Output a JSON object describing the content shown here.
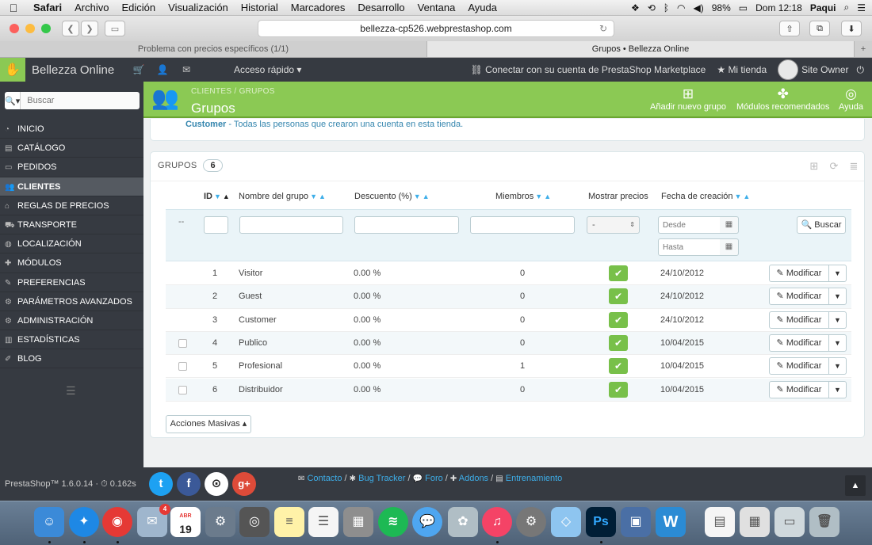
{
  "menubar": {
    "app": "Safari",
    "menus": [
      "Archivo",
      "Edición",
      "Visualización",
      "Historial",
      "Marcadores",
      "Desarrollo",
      "Ventana",
      "Ayuda"
    ],
    "battery": "98%",
    "clock": "Dom 12:18",
    "user": "Paqui"
  },
  "browser": {
    "url": "bellezza-cp526.webprestashop.com",
    "tabs": [
      {
        "title": "Problema con precios específicos (1/1)",
        "active": false
      },
      {
        "title": "Grupos • Bellezza Online",
        "active": true
      }
    ],
    "new_tab": "+"
  },
  "header": {
    "shop_name": "Bellezza Online",
    "quick_access": "Acceso rápido",
    "connect": "Conectar con su cuenta de PrestaShop Marketplace",
    "my_shop": "Mi tienda",
    "owner": "Site Owner"
  },
  "sidebar": {
    "search_placeholder": "Buscar",
    "items": [
      {
        "label": "INICIO",
        "icon": "dashboard-icon"
      },
      {
        "label": "CATÁLOGO",
        "icon": "book-icon"
      },
      {
        "label": "PEDIDOS",
        "icon": "credit-card-icon"
      },
      {
        "label": "CLIENTES",
        "icon": "users-icon",
        "active": true
      },
      {
        "label": "REGLAS DE PRECIOS",
        "icon": "tags-icon"
      },
      {
        "label": "TRANSPORTE",
        "icon": "truck-icon"
      },
      {
        "label": "LOCALIZACIÓN",
        "icon": "globe-icon"
      },
      {
        "label": "MÓDULOS",
        "icon": "puzzle-icon"
      },
      {
        "label": "PREFERENCIAS",
        "icon": "wrench-icon"
      },
      {
        "label": "PARÁMETROS AVANZADOS",
        "icon": "cogs-icon"
      },
      {
        "label": "ADMINISTRACIÓN",
        "icon": "cog-icon"
      },
      {
        "label": "ESTADÍSTICAS",
        "icon": "bar-chart-icon"
      },
      {
        "label": "BLOG",
        "icon": "edit-icon"
      }
    ]
  },
  "page": {
    "breadcrumb": [
      "CLIENTES",
      "GRUPOS"
    ],
    "title": "Grupos",
    "actions": {
      "add": "Añadir nuevo grupo",
      "modules": "Módulos recomendados",
      "help": "Ayuda"
    },
    "info_bold": "Customer",
    "info_text": " - Todas las personas que crearon una cuenta en esta tienda."
  },
  "groups": {
    "title": "GRUPOS",
    "count": "6",
    "columns": {
      "id": "ID",
      "name": "Nombre del grupo",
      "discount": "Descuento (%)",
      "members": "Miembros",
      "show_prices": "Mostrar precios",
      "created": "Fecha de creación"
    },
    "filters": {
      "dash": "--",
      "select_value": "-",
      "from": "Desde",
      "to": "Hasta",
      "search": "Buscar"
    },
    "rows": [
      {
        "id": "1",
        "name": "Visitor",
        "discount": "0.00 %",
        "members": "0",
        "date": "24/10/2012",
        "checkbox": false
      },
      {
        "id": "2",
        "name": "Guest",
        "discount": "0.00 %",
        "members": "0",
        "date": "24/10/2012",
        "checkbox": false
      },
      {
        "id": "3",
        "name": "Customer",
        "discount": "0.00 %",
        "members": "0",
        "date": "24/10/2012",
        "checkbox": false
      },
      {
        "id": "4",
        "name": "Publico",
        "discount": "0.00 %",
        "members": "0",
        "date": "10/04/2015",
        "checkbox": true
      },
      {
        "id": "5",
        "name": "Profesional",
        "discount": "0.00 %",
        "members": "1",
        "date": "10/04/2015",
        "checkbox": true
      },
      {
        "id": "6",
        "name": "Distribuidor",
        "discount": "0.00 %",
        "members": "0",
        "date": "10/04/2015",
        "checkbox": true
      }
    ],
    "modify_label": "Modificar",
    "bulk_actions": "Acciones Masivas"
  },
  "footer": {
    "version": "PrestaShop™ 1.6.0.14 · ",
    "time": "0.162s",
    "links": [
      "Contacto",
      "Bug Tracker",
      "Foro",
      "Addons",
      "Entrenamiento"
    ]
  },
  "dock": {
    "calendar_month": "ABR",
    "calendar_day": "19",
    "mail_badge": "4"
  },
  "colors": {
    "brand_green": "#8bc954",
    "sidebar_bg": "#363a41",
    "link_blue": "#3daee9",
    "check_green": "#78c04a"
  }
}
